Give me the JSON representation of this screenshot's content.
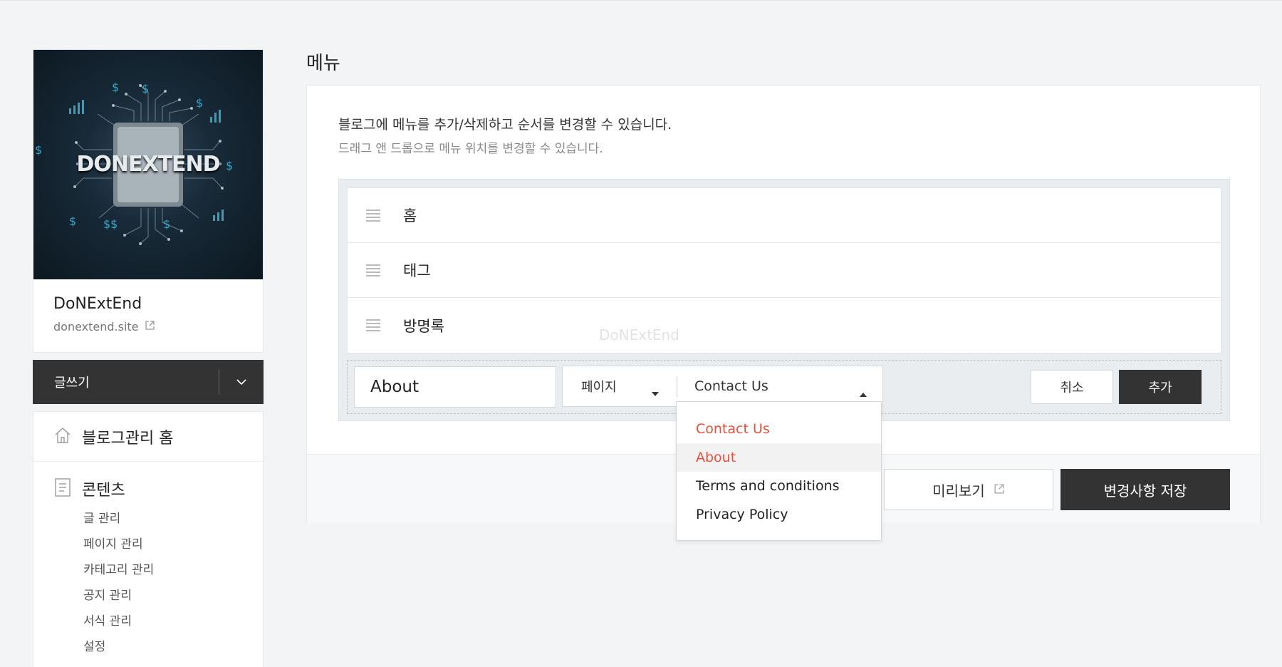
{
  "sidebar": {
    "blog_name": "DoNExtEnd",
    "blog_url": "donextend.site",
    "image_logo_text": "DONEXTEND",
    "write_label": "글쓰기",
    "nav_home": "블로그관리 홈",
    "contents_label": "콘텐츠",
    "contents_items": [
      "글 관리",
      "페이지 관리",
      "카테고리 관리",
      "공지 관리",
      "서식 관리",
      "설정"
    ]
  },
  "main": {
    "title": "메뉴",
    "desc_primary": "블로그에 메뉴를 추가/삭제하고 순서를 변경할 수 있습니다.",
    "desc_secondary": "드래그 앤 드롭으로 메뉴 위치를 변경할 수 있습니다.",
    "menu_items": [
      {
        "label": "홈"
      },
      {
        "label": "태그"
      },
      {
        "label": "방명록"
      }
    ],
    "watermark": "DoNExtEnd",
    "add_row": {
      "name_value": "About",
      "type_value": "페이지",
      "page_value": "Contact Us",
      "cancel_label": "취소",
      "add_label": "추가"
    },
    "preview_label": "미리보기",
    "save_label": "변경사항 저장"
  },
  "dropdown": {
    "options": [
      "Contact Us",
      "About",
      "Terms and conditions",
      "Privacy Policy"
    ],
    "selected": "Contact Us",
    "hovered": "About"
  },
  "colors": {
    "accent": "#e6503e",
    "dark_button": "#333333",
    "background": "#f3f4f6"
  }
}
